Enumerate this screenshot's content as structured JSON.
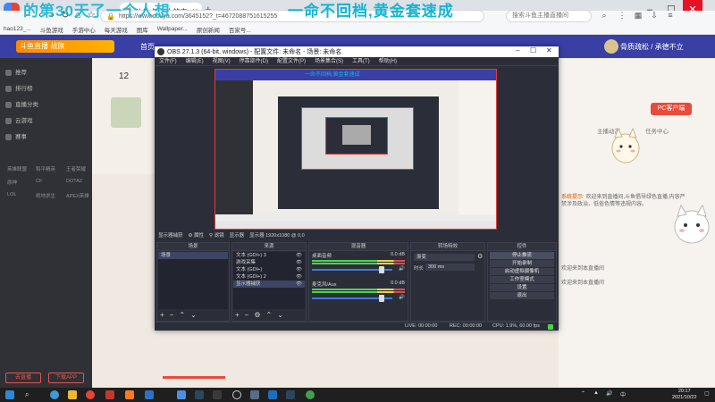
{
  "browser": {
    "tab_title": "斗鱼-每个人的直播平台",
    "url": "https://www.douyu.com/3645152?_t=4672088751615255",
    "search_placeholder": "搜索斗鱼主播直播间",
    "bookmarks": [
      "hao123_...",
      "斗鱼游戏",
      "手游中心",
      "每天游戏",
      "图库",
      "Wallpaper...",
      "原创新闻",
      "百家号..."
    ]
  },
  "overlay": {
    "title": "的第30天了一个人想",
    "slogan": "一命不回档,黄金套速成"
  },
  "site": {
    "logo_text": "斗鱼直播 战旗",
    "nav_first": "首页",
    "user_name": "骨质疏松 / 承德不立",
    "left_menu": [
      "推荐",
      "排行榜",
      "直播分类",
      "云游戏",
      "赛事"
    ],
    "left_tags": [
      "英雄联盟",
      "和平精英",
      "王者荣耀",
      "原神",
      "CF",
      "DOTA2",
      "LOL",
      "绝地求生",
      "APEX英雄"
    ],
    "bottom_buttons": [
      "去直播",
      "下载APP"
    ],
    "view_count": "12",
    "right_badge": "PC客户端",
    "right_tabs": [
      "主播动态",
      "任务中心"
    ],
    "chat": [
      {
        "user": "系统提示:",
        "text": "欢迎来到直播间,斗鱼倡导绿色直播,内容严禁涉及政治、低俗色情等违规内容。"
      },
      {
        "user": "",
        "text": "欢迎来到本直播间"
      },
      {
        "user": "",
        "text": "欢迎来到本直播间"
      }
    ]
  },
  "obs": {
    "title": "OBS 27.1.3 (64-bit, windows) - 配置文件: 未命名 - 场景: 未命名",
    "menu": [
      "文件(F)",
      "编辑(E)",
      "视图(V)",
      "停靠部件(D)",
      "配置文件(P)",
      "场景集合(S)",
      "工具(T)",
      "帮助(H)"
    ],
    "preview_slogan": "一命不回档,黄金套速成",
    "status_items": [
      "显示器捕获",
      "属性",
      "滤镜",
      "显示器",
      "显示器 1920x1080 @ 0,0"
    ],
    "scenes_header": "场景",
    "scenes": [
      "场景"
    ],
    "sources_header": "来源",
    "sources": [
      "文本 (GDI+) 3",
      "游戏采集",
      "文本 (GDI+)",
      "文本 (GDI+) 2",
      "显示器捕获"
    ],
    "mixer_header": "混音器",
    "mixer": [
      {
        "name": "桌面音频",
        "db": "0.0 dB"
      },
      {
        "name": "麦克风/Aux",
        "db": "0.0 dB"
      }
    ],
    "transitions_header": "转场特效",
    "transition_value": "渐变",
    "duration_label": "时长",
    "duration_value": "300 ms",
    "controls_header": "控件",
    "controls": [
      "停止推流",
      "开始录制",
      "启动虚拟摄像机",
      "工作室模式",
      "设置",
      "退出"
    ],
    "footer": {
      "live": "LIVE: 00:00:00",
      "rec": "REC: 00:00:00",
      "cpu": "CPU: 1.9%, 60.00 fps"
    }
  },
  "taskbar": {
    "time": "20:17",
    "date": "2021/10/22"
  }
}
